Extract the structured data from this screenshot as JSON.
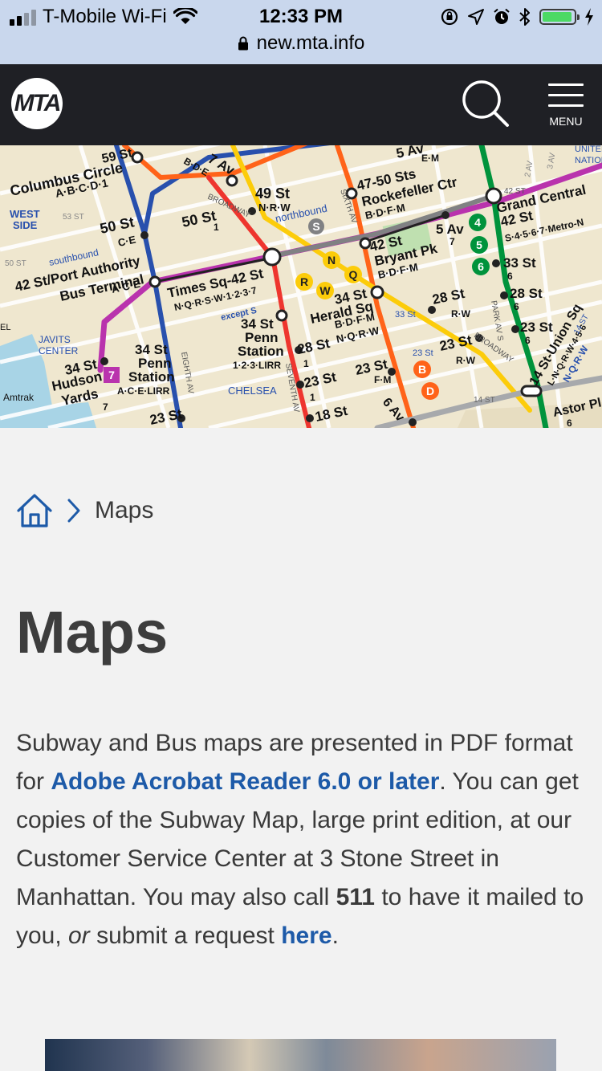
{
  "status_bar": {
    "carrier": "T-Mobile Wi-Fi",
    "time": "12:33 PM",
    "url": "new.mta.info",
    "battery_level": 0.95,
    "icons": [
      "signal-icon",
      "wifi-icon",
      "orientation-lock-icon",
      "location-icon",
      "alarm-icon",
      "bluetooth-icon",
      "battery-icon",
      "charging-icon",
      "lock-icon"
    ]
  },
  "header": {
    "logo_text": "MTA",
    "menu_label": "MENU",
    "colors": {
      "background": "#1f2025",
      "icon": "#ffffff"
    }
  },
  "map": {
    "station_labels": {
      "columbus_circle": "Columbus Circle",
      "columbus_lines": "A·B·C·D·1",
      "st59": "59 St",
      "west_side": "WEST",
      "west_side2": "SIDE",
      "st50_left": "50 St",
      "st50_left_lines": "C·E",
      "st50_mid": "50 St",
      "st50_mid_line": "1",
      "ave7": "7 Av",
      "ave7_lines": "B·D·E",
      "st49": "49 St",
      "st49_lines": "N·R·W",
      "northbound": "northbound",
      "ave5": "5 Av",
      "ave5_lines": "E·M",
      "rockefeller": "47-50 Sts",
      "rockefeller2": "Rockefeller Ctr",
      "rockefeller_lines": "B·D·F·M",
      "grand_central": "Grand Central",
      "gc_42": "42 St",
      "gc_lines": "S·4·5·6·7·Metro-N",
      "port_authority": "42 St/Port Authority",
      "port_authority2": "Bus Terminal",
      "port_authority_lines": "A·C·E",
      "southbound": "southbound",
      "times_sq": "Times Sq-42 St",
      "times_sq_lines": "N·Q·R·S·W·1·2·3·7",
      "except": "except S",
      "bryant_pk": "42 St",
      "bryant_pk2": "Bryant Pk",
      "bryant_lines": "B·D·F·M",
      "ave5_7": "5 Av",
      "ave5_7_line": "7",
      "st33": "33 St",
      "st33_line": "6",
      "st28_r": "28 St",
      "st28_r_line": "6",
      "herald_sq": "34 St",
      "herald_sq2": "Herald Sq",
      "herald_lines": "B·D·F·M",
      "herald_lines2": "N·Q·R·W",
      "penn": "34 St",
      "penn2": "Penn",
      "penn3": "Station",
      "penn_lines": "1·2·3·LIRR",
      "penn_ace": "34 St",
      "penn_ace2": "Penn",
      "penn_ace3": "Station",
      "penn_ace_lines": "A·C·E·LIRR",
      "st28_rw": "28 St",
      "st28_rw_lines": "R·W",
      "st28_1": "28 St",
      "st28_1_line": "1",
      "st23_rw": "23 St",
      "st23_rw_lines": "R·W",
      "st23_6": "23 St",
      "st23_6_line": "6",
      "st23_fm": "23 St",
      "st23_fm_lines": "F·M",
      "st23_1": "23 St",
      "st23_1_line": "1",
      "st23_ce": "23 St",
      "union_sq": "14 St-Union Sq",
      "union_lines": "L·N·Q·R·W·4·5·6",
      "nqrw": "N·Q·R·W",
      "hudson_yards": "34 St",
      "hudson_yards2": "Hudson",
      "hudson_yards3": "Yards",
      "hudson_line": "7",
      "javits": "JAVITS",
      "javits2": "CENTER",
      "amtrak": "Amtrak",
      "chelsea": "CHELSEA",
      "st18": "18 St",
      "st18_line": "1",
      "astor": "Astor Pl",
      "astor_line": "6",
      "ave6": "6 Av",
      "st14": "14 ST",
      "st14b": "14 ST",
      "st57": "53 ST",
      "st50c": "50 ST",
      "st42c": "42 ST",
      "st33c": "33 St",
      "st23c": "23 St",
      "sixth_av": "SIXTH AV",
      "eighth_av": "EIGHTH AV",
      "seventh_av": "SEVENTH AV",
      "park_av": "PARK AV S",
      "broadway": "BROADWAY",
      "broadway2": "BROADWAY",
      "un": "UNITED",
      "un2": "NATIONS",
      "ave3": "3 AV",
      "ave2": "2 AV",
      "el": "EL"
    },
    "route_colors": {
      "ace": "#2850ad",
      "bdfm": "#ff6319",
      "nqrw": "#fccc0a",
      "s": "#808183",
      "one23": "#ee352e",
      "seven": "#b933ad",
      "four56": "#00933c",
      "l": "#a7a9ac"
    },
    "bullets": {
      "n": "N",
      "q": "Q",
      "r": "R",
      "w": "W",
      "four": "4",
      "five": "5",
      "six": "6",
      "seven": "7",
      "b": "B",
      "d": "D",
      "s": "S"
    }
  },
  "breadcrumb": {
    "current": "Maps"
  },
  "page": {
    "title": "Maps",
    "intro": {
      "p1": "Subway and Bus maps are presented in PDF format for ",
      "link1": "Adobe Acrobat Reader 6.0 or later",
      "p2": ". You can get copies of the Subway Map, large print edition, at our Customer Service Center at 3 Stone Street in Manhattan. You may also call ",
      "phone": "511",
      "p3": " to have it mailed to you, ",
      "or": "or",
      "p4": " submit a request ",
      "link2": "here",
      "p5": "."
    },
    "colors": {
      "link": "#1d5aa8",
      "text": "#3a3a3a",
      "background": "#f2f2f2"
    }
  }
}
